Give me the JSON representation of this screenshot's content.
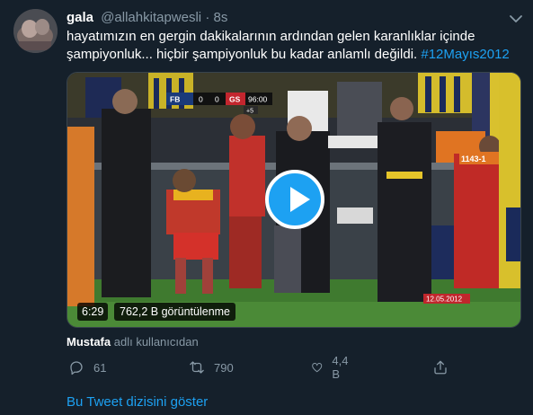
{
  "tweet": {
    "display_name": "gala",
    "handle": "@allahkitapwesli",
    "separator": "·",
    "time": "8s",
    "text_line1": "hayatımızın en gergin dakikalarının ardından gelen karanlıklar içinde",
    "text_line2": "şampiyonluk... hiçbir şampiyonluk bu kadar anlamlı değildi.",
    "hashtag": "#12Mayıs2012"
  },
  "video": {
    "duration": "6:29",
    "views": "762,2 B görüntülenme",
    "scoreboard_home": "FB",
    "scoreboard_home_score": "0",
    "scoreboard_away_score": "0",
    "scoreboard_away": "GS",
    "scoreboard_clock": "96:00",
    "scoreboard_added": "+5",
    "date_stamp": "12.05.2012",
    "banner_number": "1143-1"
  },
  "attribution": {
    "user": "Mustafa",
    "suffix": "adlı kullanıcıdan"
  },
  "actions": {
    "reply_count": "61",
    "retweet_count": "790",
    "like_count": "4,4 B"
  },
  "thread_link": "Bu Tweet dizisini göster",
  "colors": {
    "background": "#15202b",
    "accent": "#1da1f2",
    "muted": "#8899a6"
  }
}
